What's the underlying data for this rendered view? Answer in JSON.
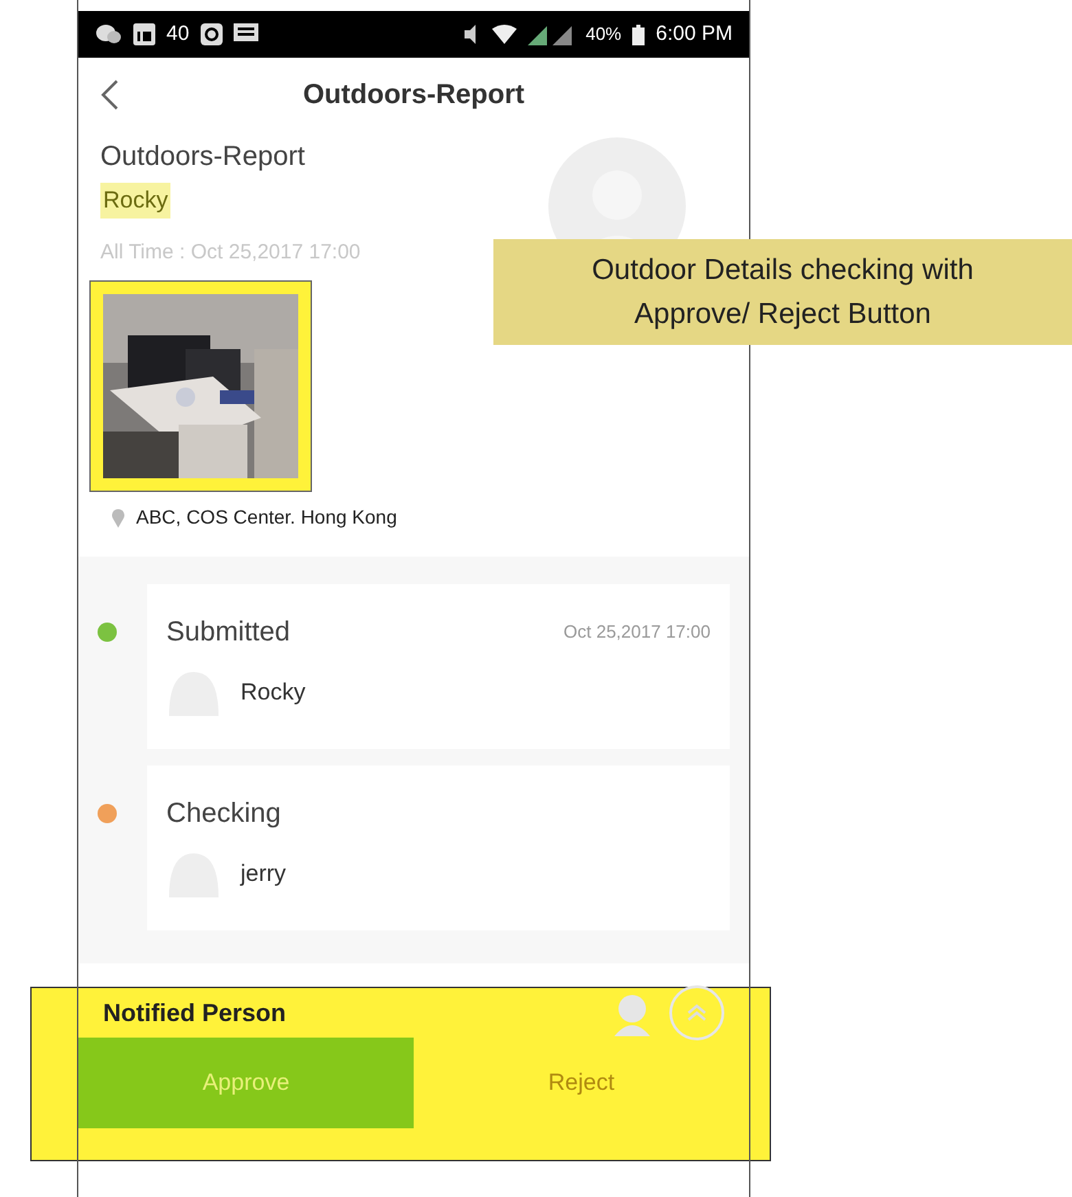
{
  "status_bar": {
    "notification_count": "40",
    "battery": "40%",
    "time": "6:00 PM"
  },
  "header": {
    "title": "Outdoors-Report"
  },
  "report": {
    "type": "Outdoors-Report",
    "name": "Rocky",
    "time": "All Time : Oct 25,2017 17:00",
    "location": "ABC, COS Center. Hong Kong"
  },
  "timeline": [
    {
      "status": "Submitted",
      "person": "Rocky",
      "date": "Oct 25,2017 17:00",
      "color": "#7cc241"
    },
    {
      "status": "Checking",
      "person": "jerry",
      "color": "#f0a05a"
    }
  ],
  "notified": {
    "label": "Notified Person"
  },
  "actions": [
    {
      "label": "Approve",
      "kind": "primary"
    },
    {
      "label": "Reject",
      "kind": "secondary"
    }
  ],
  "annotation": {
    "text": "Outdoor Details checking with Approve/ Reject Button"
  }
}
